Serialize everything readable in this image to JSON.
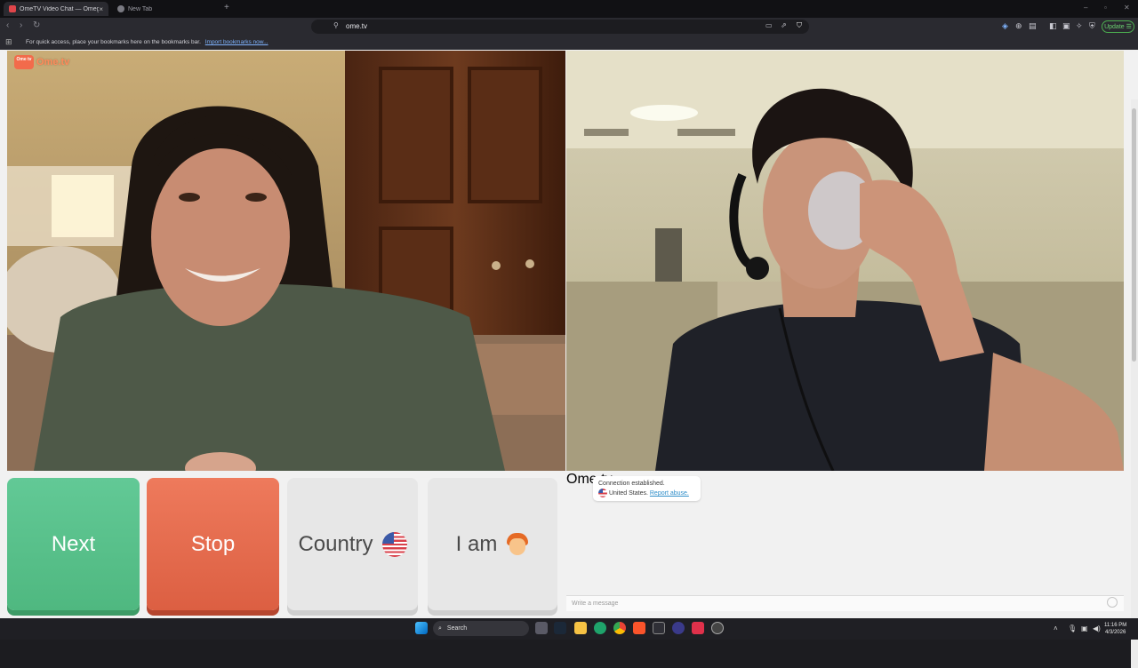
{
  "browser": {
    "tabs": [
      {
        "title": "OmeTV Video Chat — Omegle",
        "active": true
      },
      {
        "title": "New Tab",
        "active": false
      }
    ],
    "url": "ome.tv",
    "update_label": "Update",
    "bookmarks_message": "For quick access, place your bookmarks here on the bookmarks bar.",
    "bookmarks_link": "Import bookmarks now..."
  },
  "page": {
    "logo_text": "Ome.tv",
    "logo_box_text": "Ome tv",
    "buttons": {
      "next": "Next",
      "stop": "Stop",
      "country": "Country",
      "iam": "I am"
    },
    "chat": {
      "system_message": "Connection established.",
      "location": "United States.",
      "report_link": "Report abuse.",
      "input_placeholder": "Write a message"
    }
  },
  "taskbar": {
    "search_label": "Search",
    "time": "11:16 PM",
    "date": "4/3/2026"
  },
  "colors": {
    "next_green": "#5bbf8a",
    "stop_red": "#e4694b",
    "brand_orange": "#f26b4b",
    "link_blue": "#2f8ec9"
  }
}
